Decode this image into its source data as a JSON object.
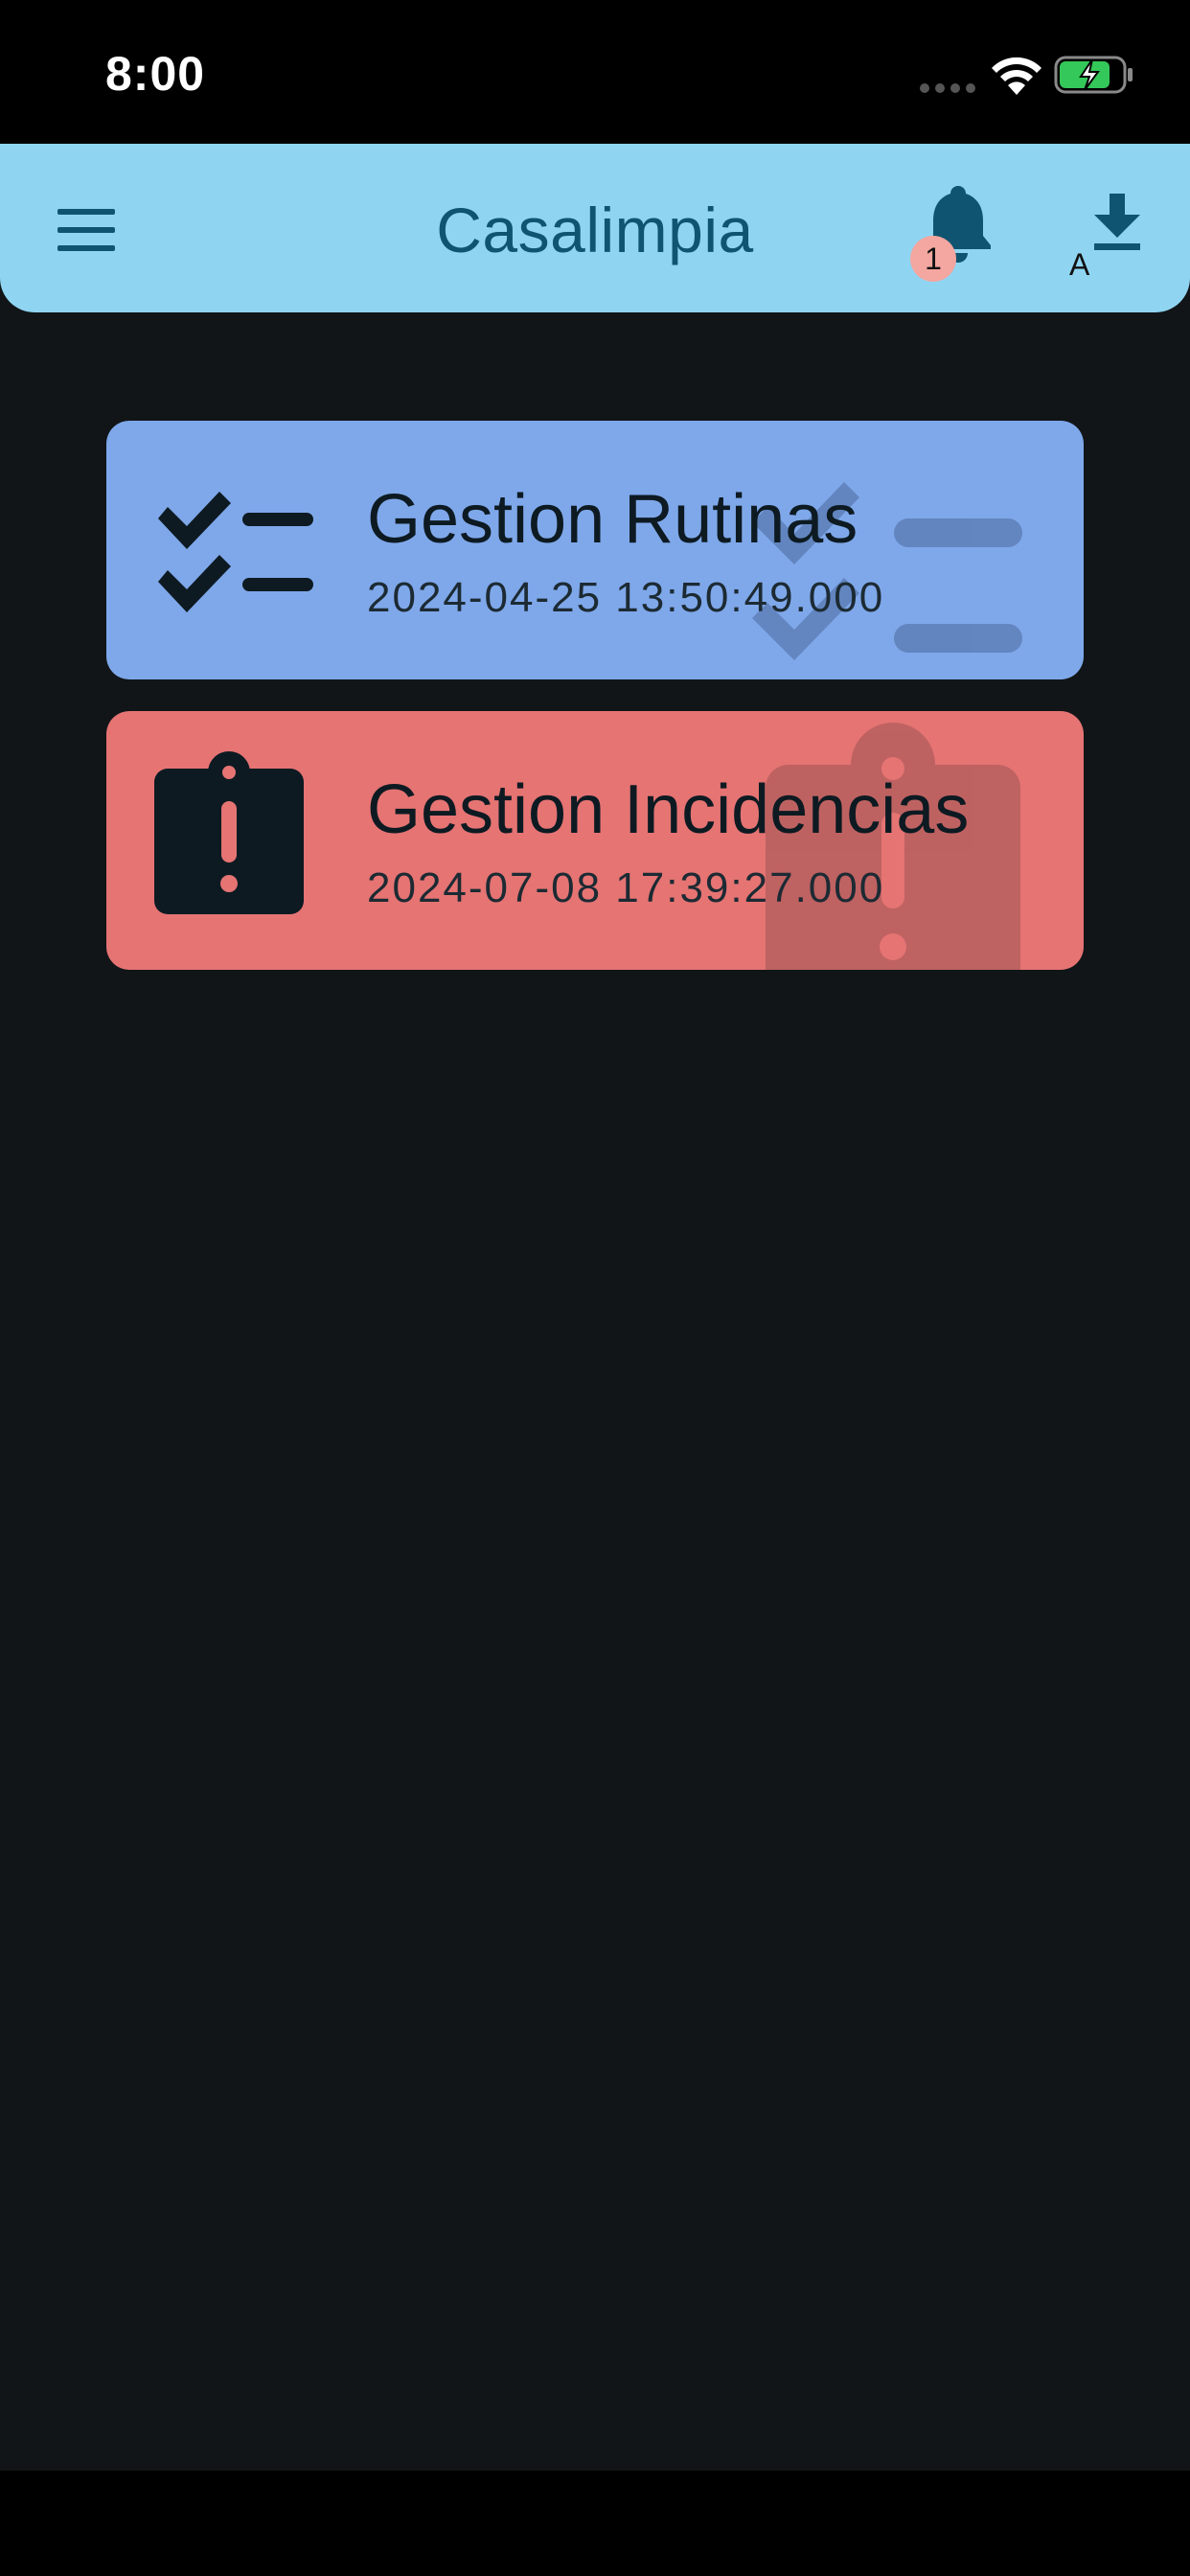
{
  "status_bar": {
    "time": "8:00"
  },
  "app_bar": {
    "title": "Casalimpia",
    "notification_count": "1",
    "download_label": "A",
    "menu_icon": "hamburger-menu-icon",
    "bell_icon": "bell-icon",
    "download_icon": "download-icon"
  },
  "cards": [
    {
      "title": "Gestion Rutinas",
      "date": "2024-04-25 13:50:49.000",
      "icon": "checklist-icon",
      "color": "#7fa8ea"
    },
    {
      "title": "Gestion Incidencias",
      "date": "2024-07-08 17:39:27.000",
      "icon": "clipboard-alert-icon",
      "color": "#e57473"
    }
  ],
  "colors": {
    "app_bar": "#8fd5f2",
    "background": "#111518",
    "title_text": "#0f5470",
    "badge": "#f4a6a0"
  }
}
